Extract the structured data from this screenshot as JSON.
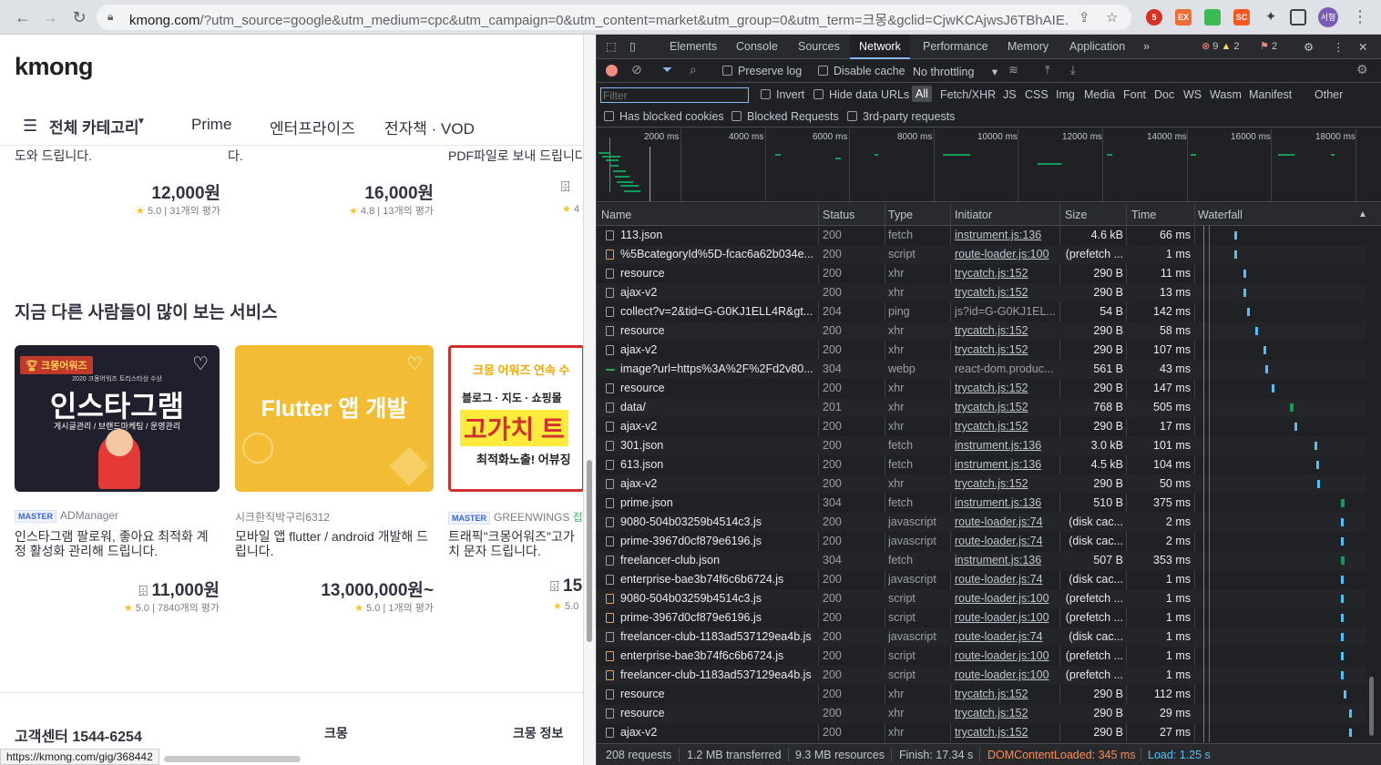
{
  "browser": {
    "url_host": "kmong.com",
    "url_rest": "/?utm_source=google&utm_medium=cpc&utm_campaign=0&utm_content=market&utm_group=0&utm_term=크몽&gclid=CjwKCAjwsJ6TBhAIE...",
    "profile": "서형",
    "ext_badge": "5",
    "ext_labels": [
      "EX",
      "SC"
    ]
  },
  "page": {
    "logo": "kmong",
    "nav": {
      "all_categories": "전체 카테고리",
      "links": [
        "Prime",
        "엔터프라이즈",
        "전자책 · VOD"
      ]
    },
    "top_cards": [
      {
        "desc": "도와 드립니다.",
        "price": "12,000원",
        "rating": "5.0",
        "reviews": "31개의 평가"
      },
      {
        "desc": "다.",
        "price": "16,000원",
        "rating": "4.8",
        "reviews": "13개의 평가"
      },
      {
        "desc": "PDF파일로 보내 드립니다",
        "price": "",
        "rating": "4",
        "reviews": ""
      }
    ],
    "section_title": "지금 다른 사람들이 많이 보는 서비스",
    "services": [
      {
        "badge": "MASTER",
        "seller": "ADManager",
        "title": "인스타그램 팔로워, 좋아요 최적화 계정 활성화 관리해 드립니다.",
        "price": "11,000원",
        "rating": "5.0",
        "reviews": "7840개의 평가",
        "thumb_top": "크몽어워즈",
        "thumb_sub": "2020 크몽어워즈 트리스타상 수상",
        "thumb_main": "인스타그램",
        "thumb_tags": "게시글관리 / 브랜드마케팅 / 운영관리"
      },
      {
        "badge": "",
        "seller": "시크한직박구리6312",
        "title": "모바일 앱 flutter / android 개발해 드립니다.",
        "price": "13,000,000원~",
        "rating": "5.0",
        "reviews": "1개의 평가",
        "thumb_main": "Flutter 앱 개발"
      },
      {
        "badge": "MASTER",
        "seller": "GREENWINGS",
        "seller_extra": "접속",
        "title": "트래픽\"크몽어워즈\"고가치 문자 드립니다.",
        "price": "15",
        "rating": "5.0",
        "reviews": "",
        "thumb_top": "크몽 어워즈 연속 수",
        "thumb_sub": "블로그 · 지도 · 쇼핑몰",
        "thumb_main": "고가치 트",
        "thumb_tags": "최적화노출! 어뷰징"
      }
    ],
    "footer": {
      "cs": "고객센터 1544-6254",
      "links": [
        "크몽",
        "크몽 정보"
      ]
    },
    "status_url": "https://kmong.com/gig/368442"
  },
  "devtools": {
    "tabs": [
      "Elements",
      "Console",
      "Sources",
      "Network",
      "Performance",
      "Memory",
      "Application"
    ],
    "more": "»",
    "errors": "9",
    "warnings": "2",
    "issues": "2",
    "toolbar": {
      "preserve_log": "Preserve log",
      "disable_cache": "Disable cache",
      "throttling": "No throttling"
    },
    "filter": {
      "placeholder": "Filter",
      "invert": "Invert",
      "hide_data": "Hide data URLs",
      "types": [
        "All",
        "Fetch/XHR",
        "JS",
        "CSS",
        "Img",
        "Media",
        "Font",
        "Doc",
        "WS",
        "Wasm",
        "Manifest",
        "Other"
      ]
    },
    "row3": {
      "blocked_cookies": "Has blocked cookies",
      "blocked_requests": "Blocked Requests",
      "third_party": "3rd-party requests"
    },
    "overview_ticks": [
      "2000 ms",
      "4000 ms",
      "6000 ms",
      "8000 ms",
      "10000 ms",
      "12000 ms",
      "14000 ms",
      "16000 ms",
      "18000 ms"
    ],
    "columns": [
      "Name",
      "Status",
      "Type",
      "Initiator",
      "Size",
      "Time",
      "Waterfall"
    ],
    "rows": [
      {
        "name": "113.json",
        "status": "200",
        "type": "fetch",
        "initiator": "instrument.js:136",
        "size": "4.6 kB",
        "time": "66 ms",
        "icon": "doc",
        "wf": 0.22
      },
      {
        "name": "%5BcategoryId%5D-fcac6a62b034e...",
        "status": "200",
        "type": "script",
        "initiator": "route-loader.js:100",
        "size": "(prefetch ...",
        "time": "1 ms",
        "icon": "script",
        "wf": 0.22
      },
      {
        "name": "resource",
        "status": "200",
        "type": "xhr",
        "initiator": "trycatch.js:152",
        "size": "290 B",
        "time": "11 ms",
        "icon": "doc",
        "wf": 0.28
      },
      {
        "name": "ajax-v2",
        "status": "200",
        "type": "xhr",
        "initiator": "trycatch.js:152",
        "size": "290 B",
        "time": "13 ms",
        "icon": "doc",
        "wf": 0.28
      },
      {
        "name": "collect?v=2&tid=G-G0KJ1ELL4R&gt...",
        "status": "204",
        "type": "ping",
        "initiator": "js?id=G-G0KJ1EL...",
        "size": "54 B",
        "time": "142 ms",
        "icon": "doc",
        "wf": 0.3
      },
      {
        "name": "resource",
        "status": "200",
        "type": "xhr",
        "initiator": "trycatch.js:152",
        "size": "290 B",
        "time": "58 ms",
        "icon": "doc",
        "wf": 0.35
      },
      {
        "name": "ajax-v2",
        "status": "200",
        "type": "xhr",
        "initiator": "trycatch.js:152",
        "size": "290 B",
        "time": "107 ms",
        "icon": "doc",
        "wf": 0.4
      },
      {
        "name": "image?url=https%3A%2F%2Fd2v80...",
        "status": "304",
        "type": "webp",
        "initiator": "react-dom.produc...",
        "size": "561 B",
        "time": "43 ms",
        "icon": "img",
        "wf": 0.41
      },
      {
        "name": "resource",
        "status": "200",
        "type": "xhr",
        "initiator": "trycatch.js:152",
        "size": "290 B",
        "time": "147 ms",
        "icon": "doc",
        "wf": 0.45
      },
      {
        "name": "data/",
        "status": "201",
        "type": "xhr",
        "initiator": "trycatch.js:152",
        "size": "768 B",
        "time": "505 ms",
        "icon": "doc",
        "wf": 0.56,
        "green": true
      },
      {
        "name": "ajax-v2",
        "status": "200",
        "type": "xhr",
        "initiator": "trycatch.js:152",
        "size": "290 B",
        "time": "17 ms",
        "icon": "doc",
        "wf": 0.59
      },
      {
        "name": "301.json",
        "status": "200",
        "type": "fetch",
        "initiator": "instrument.js:136",
        "size": "3.0 kB",
        "time": "101 ms",
        "icon": "doc",
        "wf": 0.71
      },
      {
        "name": "613.json",
        "status": "200",
        "type": "fetch",
        "initiator": "instrument.js:136",
        "size": "4.5 kB",
        "time": "104 ms",
        "icon": "doc",
        "wf": 0.72
      },
      {
        "name": "ajax-v2",
        "status": "200",
        "type": "xhr",
        "initiator": "trycatch.js:152",
        "size": "290 B",
        "time": "50 ms",
        "icon": "doc",
        "wf": 0.73
      },
      {
        "name": "prime.json",
        "status": "304",
        "type": "fetch",
        "initiator": "instrument.js:136",
        "size": "510 B",
        "time": "375 ms",
        "icon": "doc",
        "wf": 0.87,
        "green": true
      },
      {
        "name": "9080-504b03259b4514c3.js",
        "status": "200",
        "type": "javascript",
        "initiator": "route-loader.js:74",
        "size": "(disk cac...",
        "time": "2 ms",
        "icon": "doc",
        "wf": 0.87
      },
      {
        "name": "prime-3967d0cf879e6196.js",
        "status": "200",
        "type": "javascript",
        "initiator": "route-loader.js:74",
        "size": "(disk cac...",
        "time": "2 ms",
        "icon": "doc",
        "wf": 0.87
      },
      {
        "name": "freelancer-club.json",
        "status": "304",
        "type": "fetch",
        "initiator": "instrument.js:136",
        "size": "507 B",
        "time": "353 ms",
        "icon": "doc",
        "wf": 0.87,
        "green": true
      },
      {
        "name": "enterprise-bae3b74f6c6b6724.js",
        "status": "200",
        "type": "javascript",
        "initiator": "route-loader.js:74",
        "size": "(disk cac...",
        "time": "1 ms",
        "icon": "doc",
        "wf": 0.87
      },
      {
        "name": "9080-504b03259b4514c3.js",
        "status": "200",
        "type": "script",
        "initiator": "route-loader.js:100",
        "size": "(prefetch ...",
        "time": "1 ms",
        "icon": "script",
        "wf": 0.87
      },
      {
        "name": "prime-3967d0cf879e6196.js",
        "status": "200",
        "type": "script",
        "initiator": "route-loader.js:100",
        "size": "(prefetch ...",
        "time": "1 ms",
        "icon": "script",
        "wf": 0.87
      },
      {
        "name": "freelancer-club-1183ad537129ea4b.js",
        "status": "200",
        "type": "javascript",
        "initiator": "route-loader.js:74",
        "size": "(disk cac...",
        "time": "1 ms",
        "icon": "doc",
        "wf": 0.87
      },
      {
        "name": "enterprise-bae3b74f6c6b6724.js",
        "status": "200",
        "type": "script",
        "initiator": "route-loader.js:100",
        "size": "(prefetch ...",
        "time": "1 ms",
        "icon": "script",
        "wf": 0.87
      },
      {
        "name": "freelancer-club-1183ad537129ea4b.js",
        "status": "200",
        "type": "script",
        "initiator": "route-loader.js:100",
        "size": "(prefetch ...",
        "time": "1 ms",
        "icon": "script",
        "wf": 0.87
      },
      {
        "name": "resource",
        "status": "200",
        "type": "xhr",
        "initiator": "trycatch.js:152",
        "size": "290 B",
        "time": "112 ms",
        "icon": "doc",
        "wf": 0.89
      },
      {
        "name": "resource",
        "status": "200",
        "type": "xhr",
        "initiator": "trycatch.js:152",
        "size": "290 B",
        "time": "29 ms",
        "icon": "doc",
        "wf": 0.92
      },
      {
        "name": "ajax-v2",
        "status": "200",
        "type": "xhr",
        "initiator": "trycatch.js:152",
        "size": "290 B",
        "time": "27 ms",
        "icon": "doc",
        "wf": 0.92
      }
    ],
    "summary": {
      "requests": "208 requests",
      "transferred": "1.2 MB transferred",
      "resources": "9.3 MB resources",
      "finish": "Finish: 17.34 s",
      "dcl": "DOMContentLoaded: 345 ms",
      "load": "Load: 1.25 s"
    }
  }
}
